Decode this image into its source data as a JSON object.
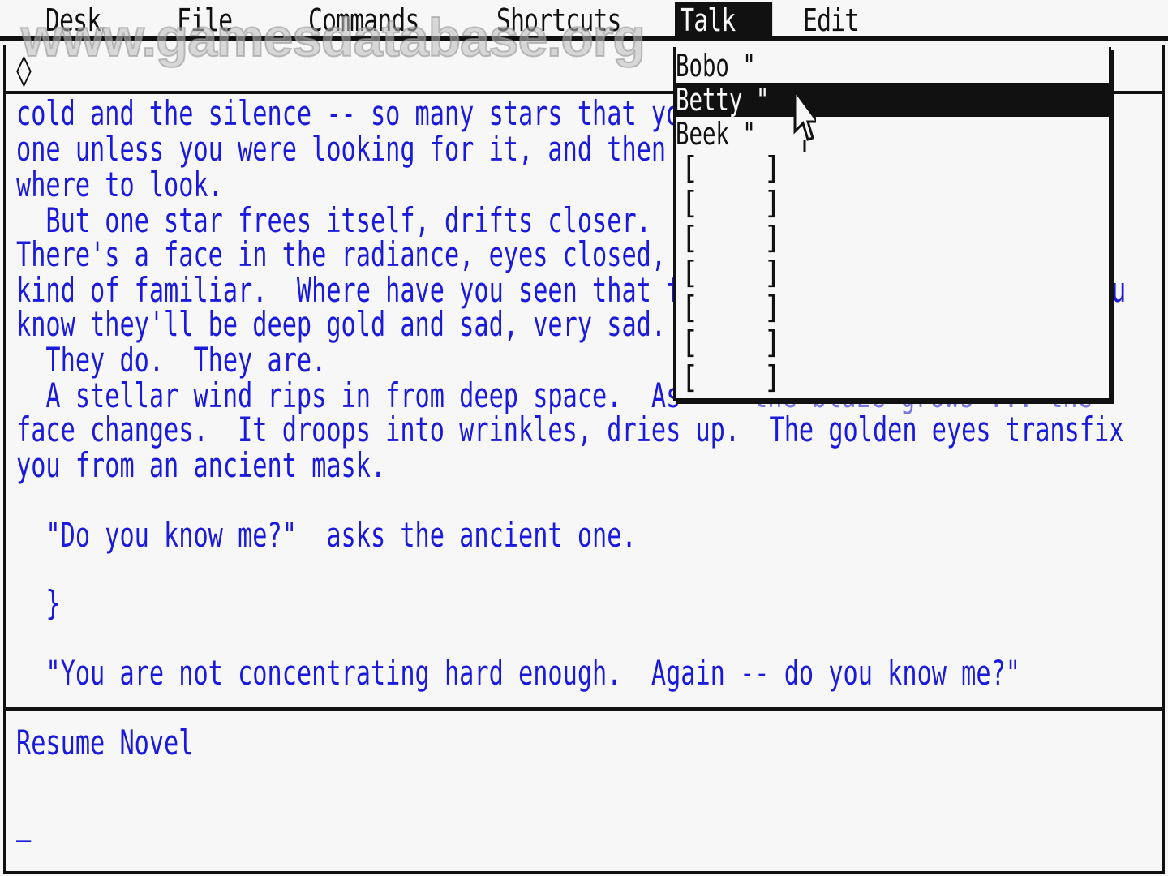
{
  "watermark": "www.gamesdatabase.org",
  "menubar": {
    "items": [
      "Desk",
      "File",
      "Commands",
      "Shortcuts",
      "Talk",
      "Edit"
    ],
    "active": "Talk"
  },
  "window": {
    "prompt_glyph": "◊"
  },
  "story": {
    "lines": [
      "cold and the silence -- so many stars that yo",
      "one unless you were looking for it, and then",
      "where to look.",
      "  But one star frees itself, drifts closer.",
      "There's a face in the radiance, eyes closed,",
      "kind of familiar.  Where have you seen that f",
      "know they'll be deep gold and sad, very sad.",
      "  They do.  They are.",
      "  A stellar wind rips in from deep space.  As",
      "face changes.  It droops into wrinkles, dries up.  The golden eyes transfix",
      "you from an ancient mask.",
      "",
      "  \"Do you know me?\"  asks the ancient one.",
      "",
      "  }",
      "",
      "  \"You are not concentrating hard enough.  Again -- do you know me?\""
    ],
    "right_edge_glyph": "u",
    "partial_line_tail": "the blaze grows ... the"
  },
  "input": {
    "command": "Resume Novel",
    "cursor": "_"
  },
  "talk_menu": {
    "items": [
      {
        "label": "Bobo \"",
        "selected": false
      },
      {
        "label": "Betty \"",
        "selected": true
      },
      {
        "label": "Beek \"",
        "selected": false
      }
    ],
    "empty_slots": 7,
    "slot_open": "[",
    "slot_close": "]"
  }
}
